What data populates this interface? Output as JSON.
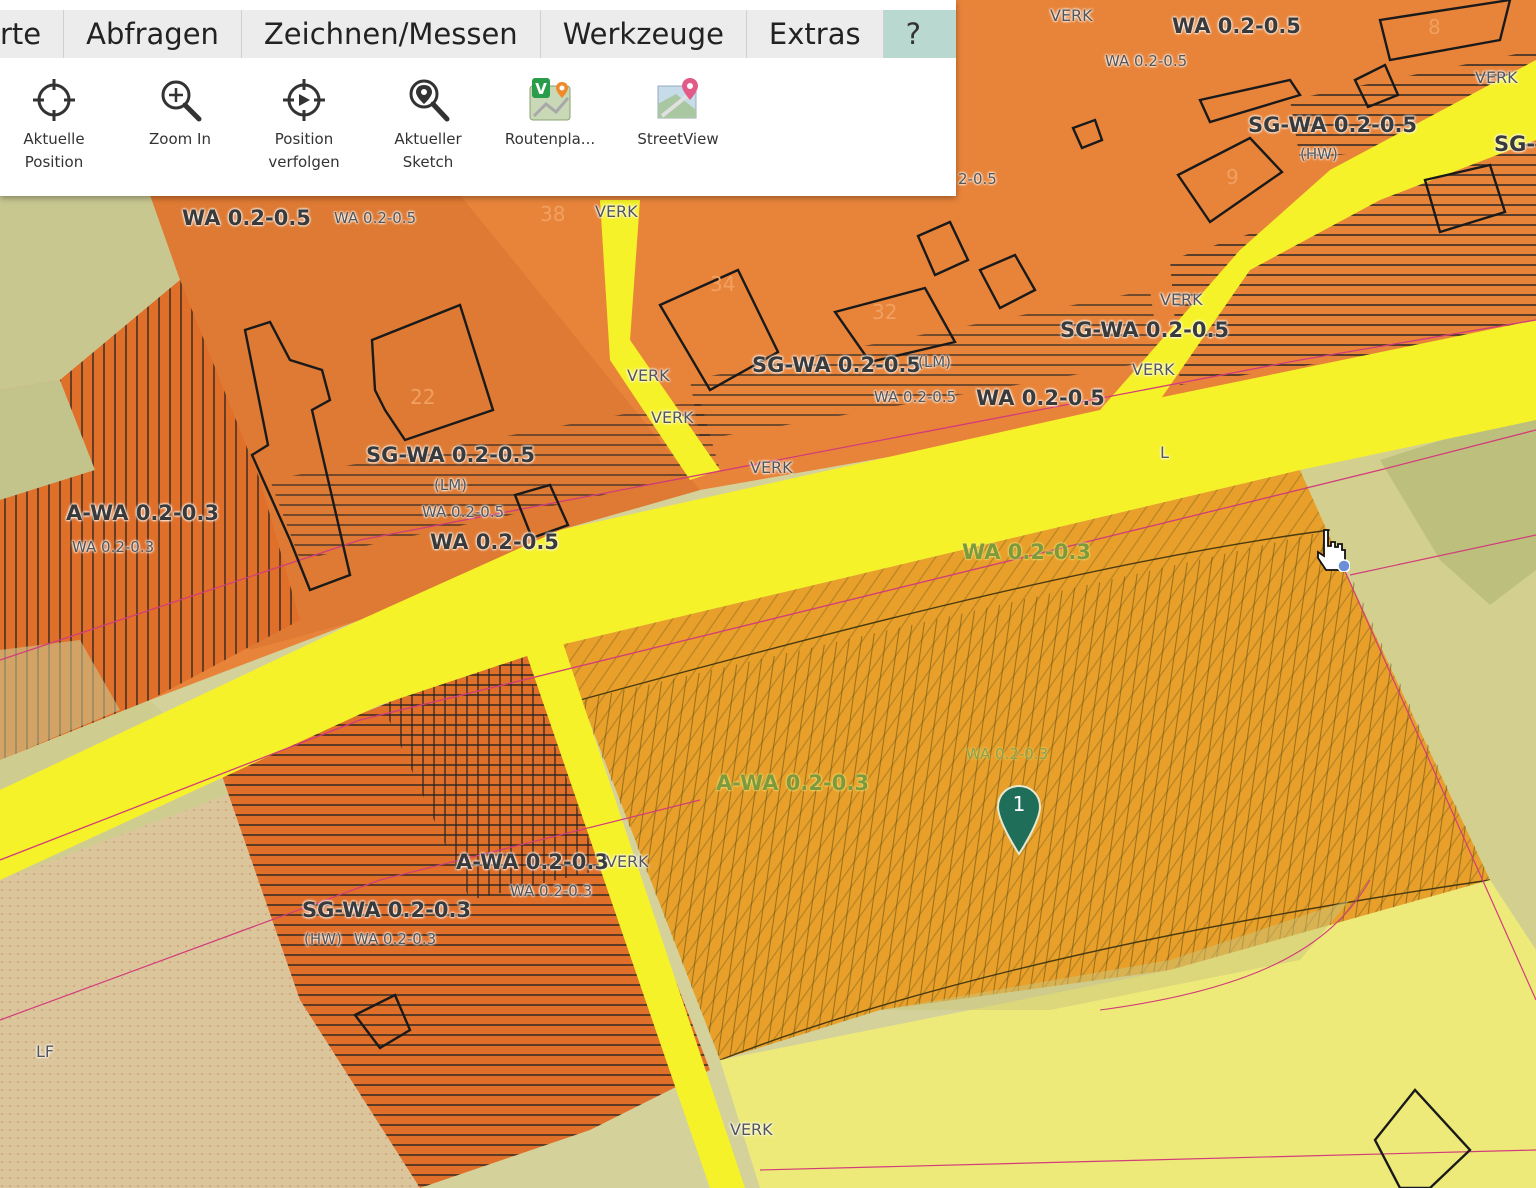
{
  "menu": {
    "items": [
      "rte",
      "Abfragen",
      "Zeichnen/Messen",
      "Werkzeuge",
      "Extras",
      "?"
    ]
  },
  "tools": [
    {
      "label_line1": "Aktuelle",
      "label_line2": "Position",
      "icon": "crosshair-icon"
    },
    {
      "label_line1": "Zoom In",
      "label_line2": "",
      "icon": "zoom-in-icon"
    },
    {
      "label_line1": "Position",
      "label_line2": "verfolgen",
      "icon": "track-position-icon"
    },
    {
      "label_line1": "Aktueller",
      "label_line2": "Sketch",
      "icon": "sketch-search-icon"
    },
    {
      "label_line1": "Routenpla...",
      "label_line2": "",
      "icon": "route-planner-icon"
    },
    {
      "label_line1": "StreetView",
      "label_line2": "",
      "icon": "streetview-icon"
    }
  ],
  "map": {
    "labels": {
      "wa_top_right": "WA 0.2-0.5",
      "wa_top_right_sm": "WA 0.2-0.5",
      "verk_top": "VERK",
      "verk_top_right": "VERK",
      "sgwa_top_right": "SG-WA 0.2-0.5",
      "hw_top_right": "(HW)",
      "sg_edge": "SG-",
      "num_8": "8",
      "num_9": "9",
      "frag_05": "2-0.5",
      "wa_left_big": "WA 0.2-0.5",
      "wa_left_sm": "WA 0.2-0.5",
      "num_38": "38",
      "verk_mid_top": "VERK",
      "num_34": "34",
      "num_32": "32",
      "verk_mid_right": "VERK",
      "sgwa_mid_right": "SG-WA 0.2-0.5",
      "verk_mid_right2": "VERK",
      "sgwa_lm": "SG-WA 0.2-0.5",
      "lm_1": "(LM)",
      "wa_mid_sm": "WA 0.2-0.5",
      "wa_mid_big": "WA 0.2-0.5",
      "verk_a": "VERK",
      "verk_b": "VERK",
      "verk_c": "VERK",
      "l_label": "L",
      "sgwa_center": "SG-WA 0.2-0.5",
      "lm_2": "(LM)",
      "wa_center_sm": "WA 0.2-0.5",
      "wa_center_big": "WA 0.2-0.5",
      "awa_left": "A-WA 0.2-0.3",
      "wa_left_sm3": "WA 0.2-0.3",
      "num_22": "22",
      "wa_green": "WA 0.2-0.3",
      "wa_green_sm": "WA 0.2-0.3",
      "awa_green": "A-WA 0.2-0.3",
      "awa_bottom": "A-WA 0.2-0.3",
      "verk_bottom": "VERK",
      "wa_bottom_sm": "WA 0.2-0.3",
      "sgwa_bottom": "SG-WA 0.2-0.3",
      "hw_bottom": "(HW)",
      "wa_bottom_sm2": "WA 0.2-0.3",
      "lf": "LF",
      "verk_bottom2": "VERK"
    },
    "marker_number": "1",
    "colors": {
      "orange": "#e8843a",
      "dark_orange": "#dd6d2a",
      "yellow_road": "#f6f22a",
      "amber": "#e8a02a",
      "pale_green": "#d6d49a",
      "marker": "#1f6e5a"
    }
  }
}
